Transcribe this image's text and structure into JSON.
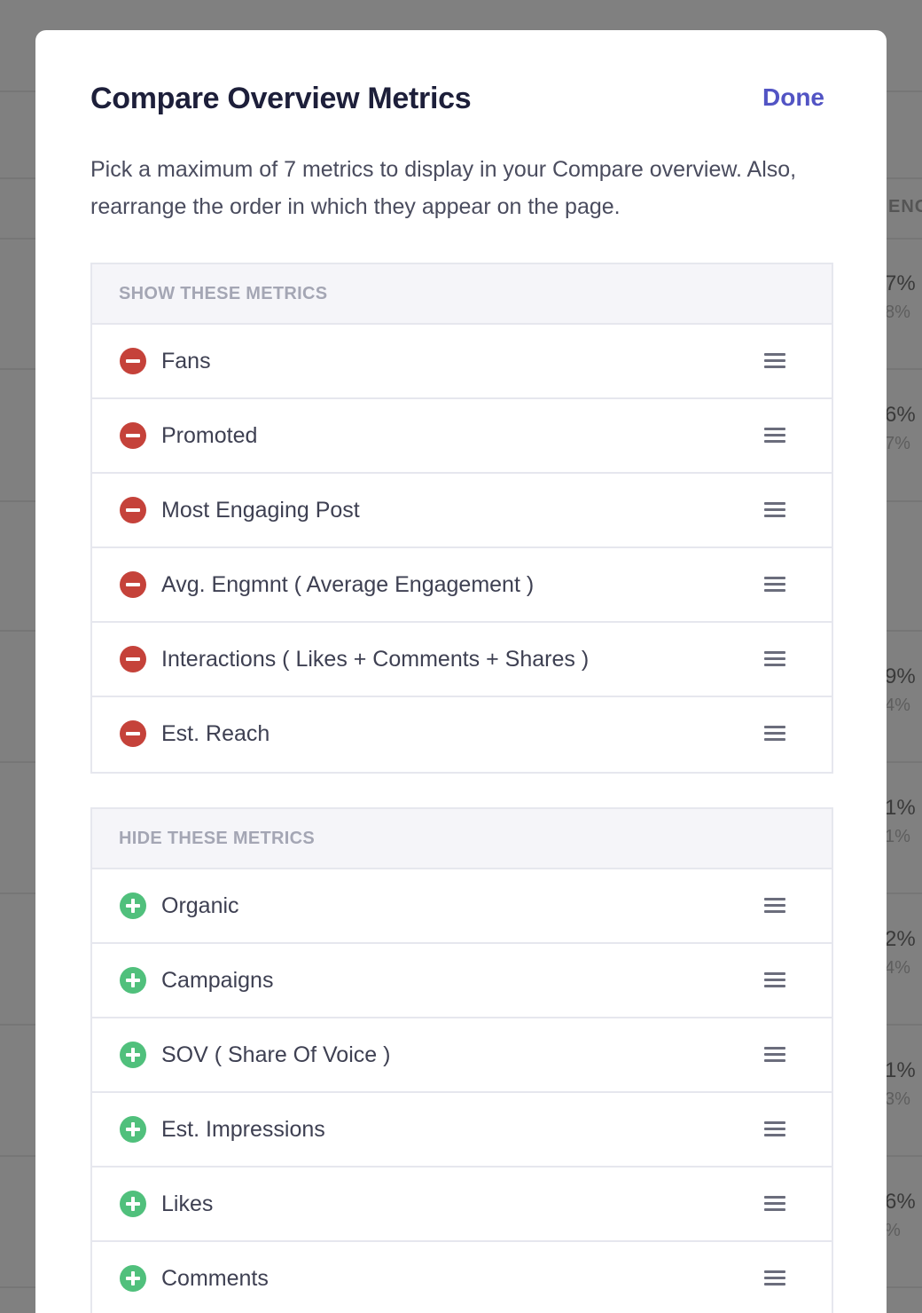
{
  "background": {
    "column_header": "ENGM",
    "cells": [
      {
        "value": "7%",
        "sub": "8%"
      },
      {
        "value": "6%",
        "sub": "7%"
      },
      {
        "value": "9%",
        "sub": "4%"
      },
      {
        "value": "1%",
        "sub": "1%"
      },
      {
        "value": "2%",
        "sub": "4%"
      },
      {
        "value": "1%",
        "sub": "3%"
      },
      {
        "value": "6%",
        "sub": "%"
      }
    ]
  },
  "modal": {
    "title": "Compare Overview Metrics",
    "done_label": "Done",
    "description": "Pick a maximum of 7 metrics to display in your Compare overview. Also, rearrange the order in which they appear on the page.",
    "show_section": {
      "header": "SHOW THESE METRICS",
      "items": [
        {
          "label": "Fans"
        },
        {
          "label": "Promoted"
        },
        {
          "label": "Most Engaging Post"
        },
        {
          "label": "Avg. Engmnt ( Average Engagement )"
        },
        {
          "label": "Interactions ( Likes + Comments + Shares )"
        },
        {
          "label": "Est. Reach"
        }
      ]
    },
    "hide_section": {
      "header": "HIDE THESE METRICS",
      "items": [
        {
          "label": "Organic"
        },
        {
          "label": "Campaigns"
        },
        {
          "label": "SOV ( Share Of Voice )"
        },
        {
          "label": "Est. Impressions"
        },
        {
          "label": "Likes"
        },
        {
          "label": "Comments"
        }
      ]
    }
  },
  "colors": {
    "accent": "#5254c4",
    "remove": "#c5423a",
    "add": "#50c07c"
  }
}
